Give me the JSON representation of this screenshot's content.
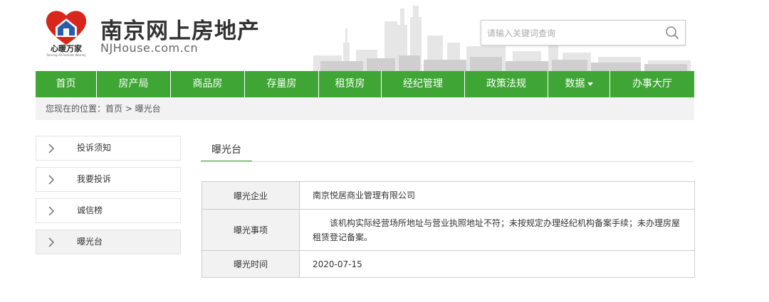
{
  "header": {
    "logo_text": "心暖万家",
    "logo_sub": "Serving All Families Warmly",
    "site_title": "南京网上房地产",
    "site_domain": "NJHouse.com.cn",
    "search_placeholder": "请输入关键词查询"
  },
  "nav": {
    "items": [
      {
        "label": "首页"
      },
      {
        "label": "房产局"
      },
      {
        "label": "商品房"
      },
      {
        "label": "存量房"
      },
      {
        "label": "租赁房"
      },
      {
        "label": "经纪管理"
      },
      {
        "label": "政策法规"
      },
      {
        "label": "数据"
      },
      {
        "label": "办事大厅"
      }
    ]
  },
  "breadcrumb": {
    "text": "您现在的位置：首页 > 曝光台"
  },
  "sidebar": {
    "items": [
      {
        "label": "投诉须知"
      },
      {
        "label": "我要投诉"
      },
      {
        "label": "诚信榜"
      },
      {
        "label": "曝光台"
      }
    ]
  },
  "content": {
    "tab_title": "曝光台",
    "rows": [
      {
        "key": "曝光企业",
        "value": "南京悦居商业管理有限公司"
      },
      {
        "key": "曝光事项",
        "value": "该机构实际经营场所地址与营业执照地址不符；未按规定办理经纪机构备案手续；未办理房屋租赁登记备案。"
      },
      {
        "key": "曝光时间",
        "value": "2020-07-15"
      }
    ]
  },
  "colors": {
    "nav_green": "#3fa535",
    "logo_red": "#d9261c",
    "logo_blue": "#2b5ca8"
  }
}
